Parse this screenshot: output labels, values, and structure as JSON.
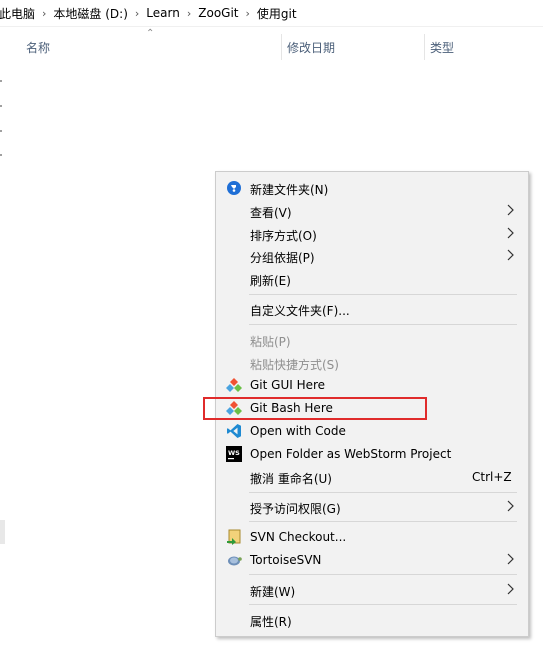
{
  "breadcrumb": {
    "items": [
      "此电脑",
      "本地磁盘 (D:)",
      "Learn",
      "ZooGit",
      "使用git"
    ]
  },
  "columns": {
    "name": "名称",
    "date": "修改日期",
    "type": "类型"
  },
  "context_menu": {
    "new_folder": "新建文件夹(N)",
    "view": "查看(V)",
    "sort_by": "排序方式(O)",
    "group_by": "分组依据(P)",
    "refresh": "刷新(E)",
    "customize_folder": "自定义文件夹(F)...",
    "paste": "粘贴(P)",
    "paste_shortcut": "粘贴快捷方式(S)",
    "git_gui": "Git GUI Here",
    "git_bash": "Git Bash Here",
    "open_with_code": "Open with Code",
    "open_webstorm": "Open Folder as WebStorm Project",
    "undo_rename": "撤消 重命名(U)",
    "undo_shortcut": "Ctrl+Z",
    "give_access": "授予访问权限(G)",
    "svn_checkout": "SVN Checkout...",
    "tortoise_svn": "TortoiseSVN",
    "new": "新建(W)",
    "properties": "属性(R)"
  },
  "colors": {
    "highlight_border": "#e02b2b",
    "menu_background": "#f2f2f2",
    "disabled_text": "#8f8f8f",
    "header_text": "#4c607a"
  },
  "icons": {
    "new_folder": "new-folder-icon",
    "git_gui": "git-gui-icon",
    "git_bash": "git-bash-icon",
    "vscode": "vscode-icon",
    "webstorm": "webstorm-icon",
    "svn_checkout": "svn-checkout-icon",
    "tortoise_svn": "tortoisesvn-icon"
  }
}
